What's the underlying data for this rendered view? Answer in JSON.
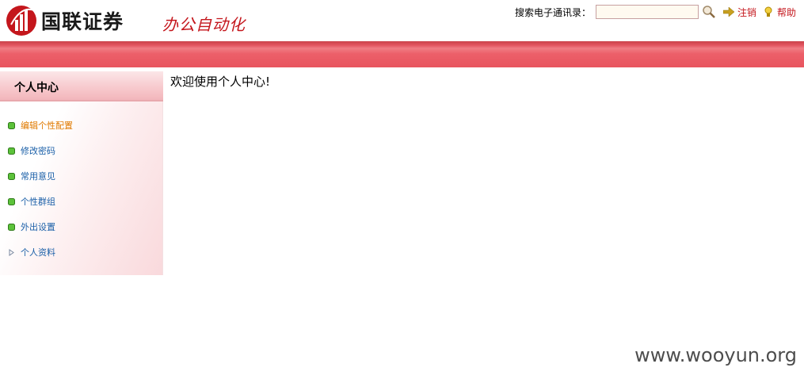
{
  "header": {
    "logo_text": "国联证券",
    "app_title": "办公自动化"
  },
  "toolbar": {
    "search_label": "搜索电子通讯录：",
    "search_value": "",
    "search_icon": "search-icon",
    "logout_label": "注销",
    "help_label": "帮助"
  },
  "sidebar": {
    "title": "个人中心",
    "items": [
      {
        "label": "编辑个性配置",
        "icon": "green-square-bullet",
        "active": true
      },
      {
        "label": "修改密码",
        "icon": "green-square-bullet"
      },
      {
        "label": "常用意见",
        "icon": "green-square-bullet"
      },
      {
        "label": "个性群组",
        "icon": "green-square-bullet"
      },
      {
        "label": "外出设置",
        "icon": "green-square-bullet"
      },
      {
        "label": "个人资料",
        "icon": "triangle-right"
      }
    ]
  },
  "main": {
    "welcome_text": "欢迎使用个人中心!"
  },
  "watermark": "www.wooyun.org",
  "colors": {
    "brand_red": "#c4161c",
    "band_red": "#e8555f",
    "link_blue": "#1a5fa8",
    "active_orange": "#e07a00"
  }
}
